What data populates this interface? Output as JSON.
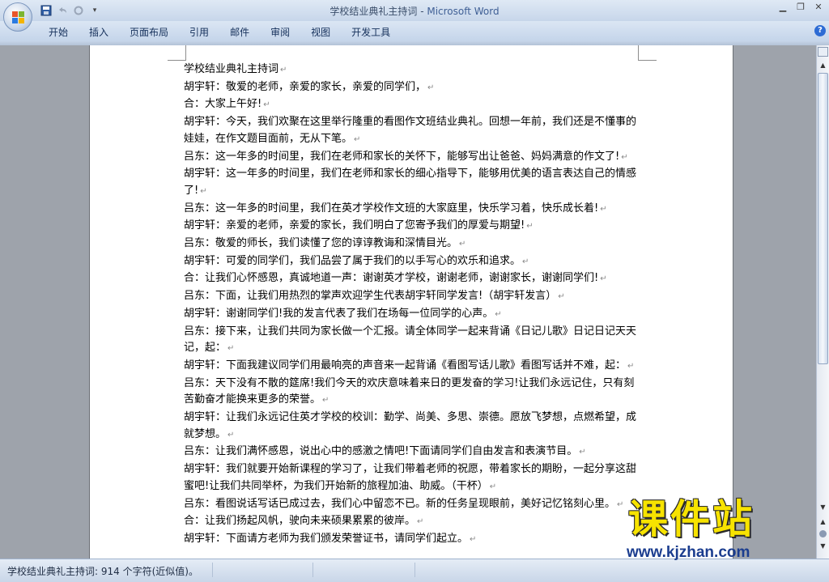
{
  "window": {
    "title_doc": "学校结业典礼主持词",
    "title_sep": " - ",
    "title_app": "Microsoft Word",
    "controls": [
      "minimize-icon",
      "restore-icon",
      "close-icon"
    ]
  },
  "qat": {
    "icons": [
      "save-icon",
      "undo-icon",
      "redo-icon",
      "customize-qat-icon"
    ],
    "dropdown_glyph": "▾"
  },
  "ribbon": {
    "tabs": [
      "开始",
      "插入",
      "页面布局",
      "引用",
      "邮件",
      "审阅",
      "视图",
      "开发工具"
    ],
    "help_glyph": "?"
  },
  "document": {
    "paragraphs": [
      "学校结业典礼主持词",
      "胡宇轩：敬爱的老师，亲爱的家长，亲爱的同学们，",
      "合：大家上午好!",
      "胡宇轩：今天，我们欢聚在这里举行隆重的看图作文班结业典礼。回想一年前，我们还是不懂事的娃娃，在作文题目面前，无从下笔。",
      "吕东：这一年多的时间里，我们在老师和家长的关怀下，能够写出让爸爸、妈妈满意的作文了!",
      "胡宇轩：这一年多的时间里，我们在老师和家长的细心指导下，能够用优美的语言表达自己的情感了!",
      "吕东：这一年多的时间里，我们在英才学校作文班的大家庭里，快乐学习着，快乐成长着!",
      "胡宇轩：亲爱的老师，亲爱的家长，我们明白了您寄予我们的厚爱与期望!",
      "吕东：敬爱的师长，我们读懂了您的谆谆教诲和深情目光。",
      "胡宇轩：可爱的同学们，我们品尝了属于我们的以手写心的欢乐和追求。",
      "合：让我们心怀感恩，真诚地道一声：谢谢英才学校，谢谢老师，谢谢家长，谢谢同学们!",
      "吕东：下面，让我们用热烈的掌声欢迎学生代表胡宇轩同学发言!（胡宇轩发言）",
      "胡宇轩：谢谢同学们!我的发言代表了我们在场每一位同学的心声。",
      "吕东：接下来，让我们共同为家长做一个汇报。请全体同学一起来背诵《日记儿歌》日记日记天天记，起：",
      "胡宇轩：下面我建议同学们用最响亮的声音来一起背诵《看图写话儿歌》看图写话并不难，起：",
      "吕东：天下没有不散的筵席!我们今天的欢庆意味着来日的更发奋的学习!让我们永远记住，只有刻苦勤奋才能换来更多的荣誉。",
      "胡宇轩：让我们永远记住英才学校的校训：勤学、尚美、多思、崇德。愿放飞梦想，点燃希望，成就梦想。",
      "吕东：让我们满怀感恩，说出心中的感激之情吧!下面请同学们自由发言和表演节目。",
      "胡宇轩：我们就要开始新课程的学习了，让我们带着老师的祝愿，带着家长的期盼，一起分享这甜蜜吧!让我们共同举杯，为我们开始新的旅程加油、助威。（干杯）",
      "吕东：看图说话写话已成过去，我们心中留恋不已。新的任务呈现眼前，美好记忆铭刻心里。",
      "合：让我们扬起风帆，驶向未来硕果累累的彼岸。",
      "胡宇轩：下面请方老师为我们颁发荣誉证书，请同学们起立。"
    ],
    "paragraph_mark": "↵"
  },
  "statusbar": {
    "text": "学校结业典礼主持词: 914 个字符(近似值)。"
  },
  "watermark": {
    "text": "课件站",
    "url": "www.kjzhan.com"
  },
  "scrollbar": {
    "up_glyph": "▲",
    "down_glyph": "▼",
    "prev_glyph": "▲",
    "next_glyph": "▼"
  }
}
